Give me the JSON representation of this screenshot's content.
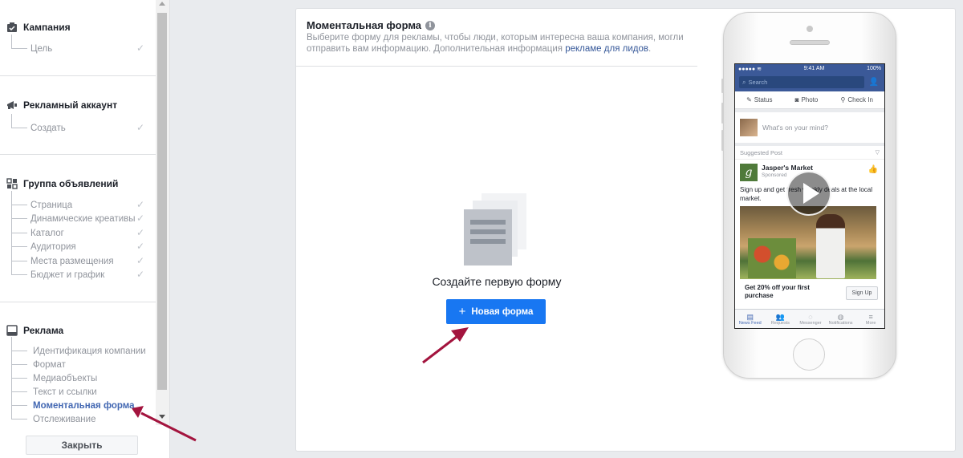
{
  "sidebar": {
    "sections": [
      {
        "title": "Кампания",
        "icon": "campaign-icon",
        "items": [
          {
            "label": "Цель",
            "done": true
          }
        ]
      },
      {
        "title": "Рекламный аккаунт",
        "icon": "megaphone-icon",
        "items": [
          {
            "label": "Создать",
            "done": true
          }
        ]
      },
      {
        "title": "Группа объявлений",
        "icon": "grid-icon",
        "items": [
          {
            "label": "Страница",
            "done": true
          },
          {
            "label": "Динамические креативы",
            "done": true
          },
          {
            "label": "Каталог",
            "done": true
          },
          {
            "label": "Аудитория",
            "done": true
          },
          {
            "label": "Места размещения",
            "done": true
          },
          {
            "label": "Бюджет и график",
            "done": true
          }
        ]
      },
      {
        "title": "Реклама",
        "icon": "ad-icon",
        "items": [
          {
            "label": "Идентификация компании"
          },
          {
            "label": "Формат"
          },
          {
            "label": "Медиаобъекты"
          },
          {
            "label": "Текст и ссылки"
          },
          {
            "label": "Моментальная форма",
            "active": true
          },
          {
            "label": "Отслеживание"
          }
        ]
      }
    ],
    "close_label": "Закрыть"
  },
  "panel": {
    "title": "Моментальная форма",
    "description": "Выберите форму для рекламы, чтобы люди, которым интересна ваша компания, могли отправить вам информацию. Дополнительная информация",
    "link_text": "рекламе для лидов",
    "link_suffix": ".",
    "empty_text": "Создайте первую форму",
    "new_form_label": "Новая форма"
  },
  "phone": {
    "time": "9:41 AM",
    "battery": "100%",
    "search_placeholder": "Search",
    "composer": {
      "status": "Status",
      "photo": "Photo",
      "checkin": "Check In"
    },
    "mind_placeholder": "What's on your mind?",
    "suggested": "Suggested Post",
    "page_name": "Jasper's Market",
    "sponsored": "Sponsored",
    "post_text": "Sign up and get fresh weekly deals at the local market.",
    "offer": "Get 20% off your first purchase",
    "signup": "Sign Up",
    "tabs": [
      "News Feed",
      "Requests",
      "Messenger",
      "Notifications",
      "More"
    ]
  },
  "colors": {
    "accent": "#1877f2",
    "link": "#365899",
    "arrow": "#a3143e",
    "fb_blue": "#3b5998"
  }
}
